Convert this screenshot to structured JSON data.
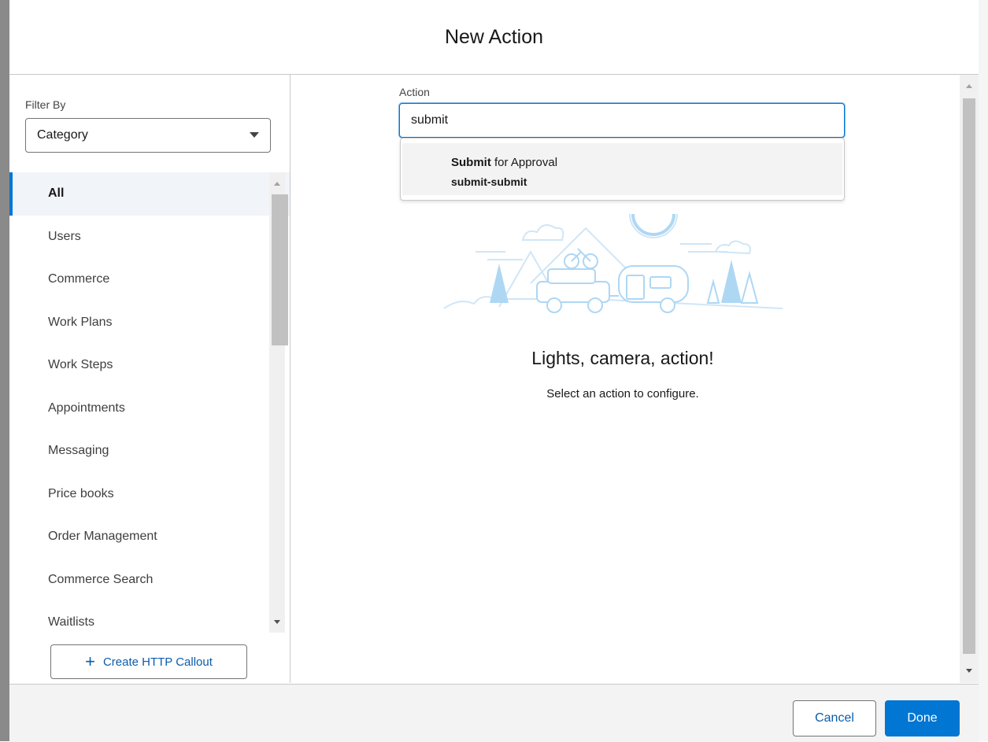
{
  "dialog": {
    "title": "New Action"
  },
  "sidebar": {
    "filter_label": "Filter By",
    "filter_value": "Category",
    "categories": [
      {
        "label": "All"
      },
      {
        "label": "Users"
      },
      {
        "label": "Commerce"
      },
      {
        "label": "Work Plans"
      },
      {
        "label": "Work Steps"
      },
      {
        "label": "Appointments"
      },
      {
        "label": "Messaging"
      },
      {
        "label": "Price books"
      },
      {
        "label": "Order Management"
      },
      {
        "label": "Commerce Search"
      },
      {
        "label": "Waitlists"
      }
    ],
    "active_category": "All",
    "create_callout_label": "Create HTTP Callout"
  },
  "main": {
    "action_label": "Action",
    "action_value": "submit",
    "dropdown": {
      "match_text": "Submit",
      "rest_text": " for Approval",
      "api_name": "submit-submit"
    },
    "empty_title": "Lights, camera, action!",
    "empty_subtitle": "Select an action to configure."
  },
  "footer": {
    "cancel_label": "Cancel",
    "done_label": "Done"
  },
  "colors": {
    "brand": "#0176d3",
    "illustration": "#aed7f4",
    "active_bg": "#f1f4f9"
  }
}
